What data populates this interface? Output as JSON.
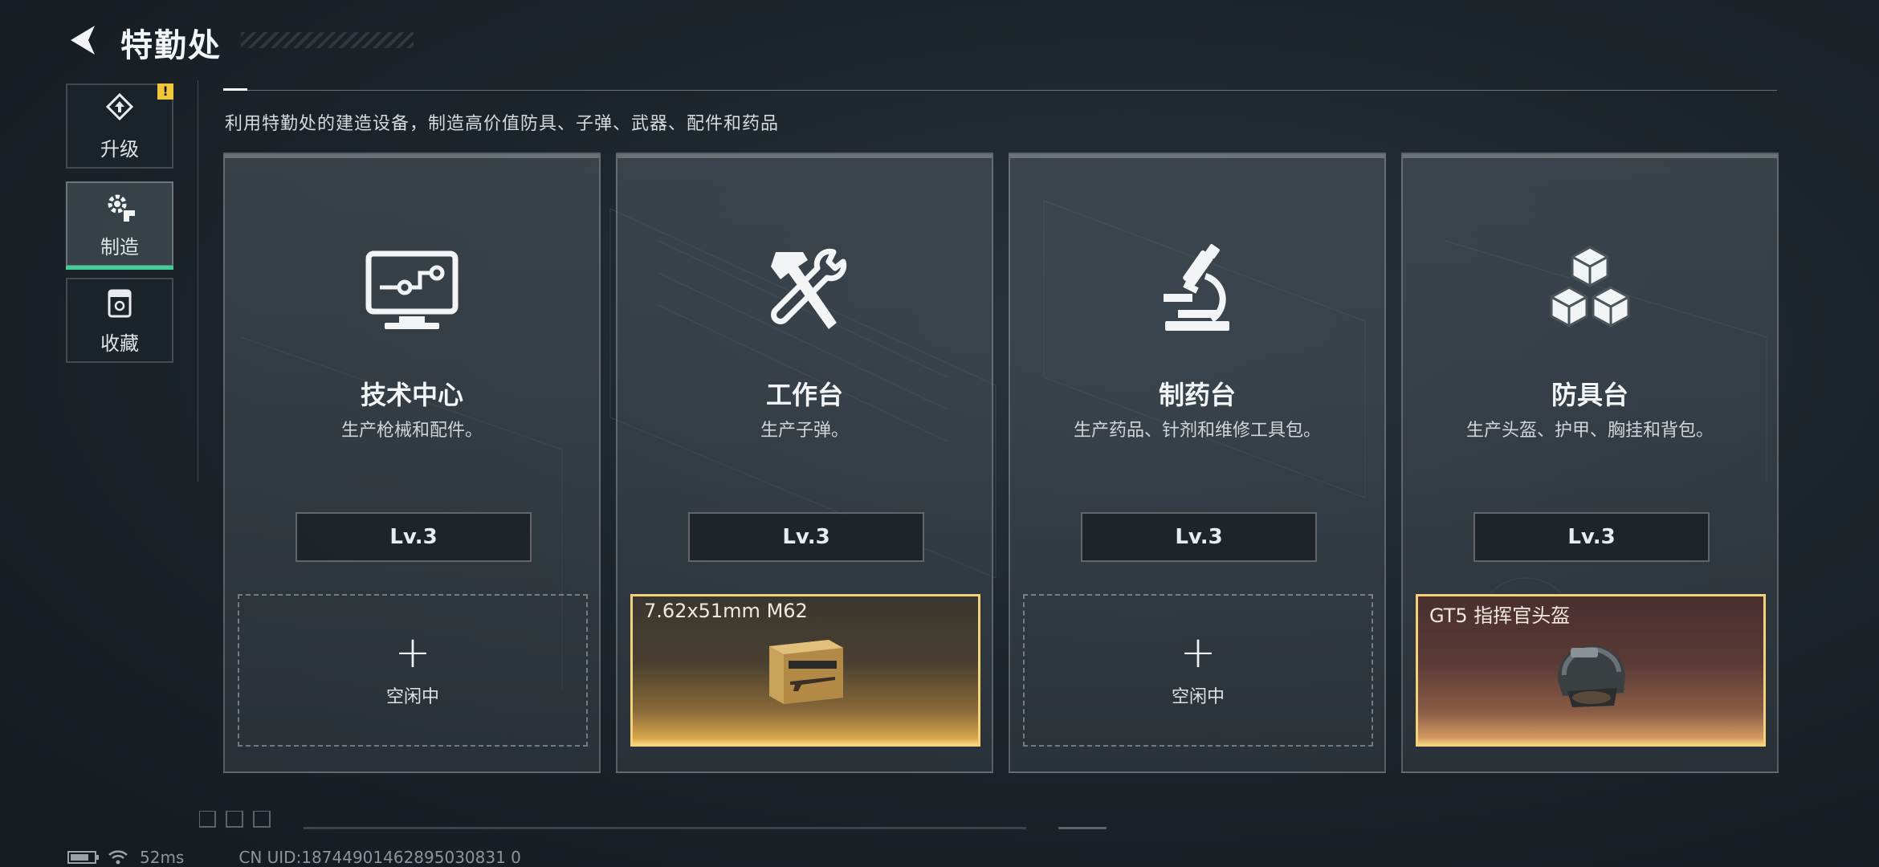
{
  "header": {
    "title": "特勤处"
  },
  "sidebar": {
    "items": [
      {
        "label": "升级",
        "icon": "upgrade-icon",
        "alert": "!"
      },
      {
        "label": "制造",
        "icon": "gear-craft-icon",
        "active": true
      },
      {
        "label": "收藏",
        "icon": "collection-icon"
      }
    ]
  },
  "description": "利用特勤处的建造设备，制造高价值防具、子弹、武器、配件和药品",
  "stations": [
    {
      "name": "技术中心",
      "sub": "生产枪械和配件。",
      "level": "Lv.3",
      "icon": "computer-icon",
      "slot": {
        "status": "empty",
        "plus": "+",
        "label": "空闲中"
      }
    },
    {
      "name": "工作台",
      "sub": "生产子弹。",
      "level": "Lv.3",
      "icon": "hammer-wrench-icon",
      "slot": {
        "status": "busy",
        "item": "7.62x51mm M62",
        "item_icon": "ammo-box-icon"
      }
    },
    {
      "name": "制药台",
      "sub": "生产药品、针剂和维修工具包。",
      "level": "Lv.3",
      "icon": "microscope-icon",
      "slot": {
        "status": "empty",
        "plus": "+",
        "label": "空闲中"
      }
    },
    {
      "name": "防具台",
      "sub": "生产头盔、护甲、胸挂和背包。",
      "level": "Lv.3",
      "icon": "cubes-icon",
      "slot": {
        "status": "busy",
        "item": "GT5 指挥官头盔",
        "item_icon": "helmet-icon"
      }
    }
  ],
  "footer": {
    "ping": "52ms",
    "uid": "CN UID:18744901462895030831 0"
  },
  "colors": {
    "active_tab": "#3fcf9a",
    "alert": "#f0c63a",
    "busy_border": "#f3d27a"
  }
}
